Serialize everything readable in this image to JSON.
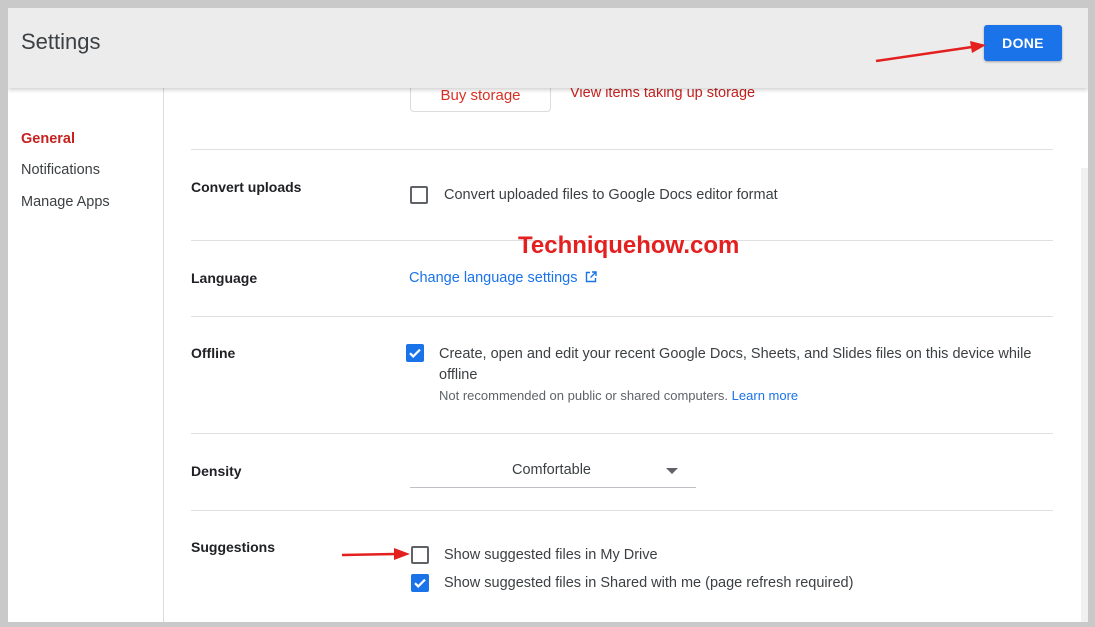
{
  "header": {
    "title": "Settings",
    "done_label": "DONE"
  },
  "sidebar": {
    "items": [
      {
        "label": "General",
        "active": true
      },
      {
        "label": "Notifications",
        "active": false
      },
      {
        "label": "Manage Apps",
        "active": false
      }
    ]
  },
  "storage": {
    "buy_label": "Buy storage",
    "view_label": "View items taking up storage"
  },
  "convert_uploads": {
    "label": "Convert uploads",
    "option": "Convert uploaded files to Google Docs editor format",
    "checked": false
  },
  "language": {
    "label": "Language",
    "link": "Change language settings"
  },
  "offline": {
    "label": "Offline",
    "option_line1": "Create, open and edit your recent Google Docs, Sheets, and Slides files on this device while",
    "option_line2": "offline",
    "note": "Not recommended on public or shared computers.",
    "learn_more": "Learn more",
    "checked": true
  },
  "density": {
    "label": "Density",
    "value": "Comfortable"
  },
  "suggestions": {
    "label": "Suggestions",
    "options": [
      {
        "label": "Show suggested files in My Drive",
        "checked": false
      },
      {
        "label": "Show suggested files in Shared with me (page refresh required)",
        "checked": true
      }
    ]
  },
  "watermark": "Techniquehow.com",
  "colors": {
    "accent": "#1a73e8",
    "active_nav": "#c5221f",
    "annotation": "#e41f1f"
  }
}
